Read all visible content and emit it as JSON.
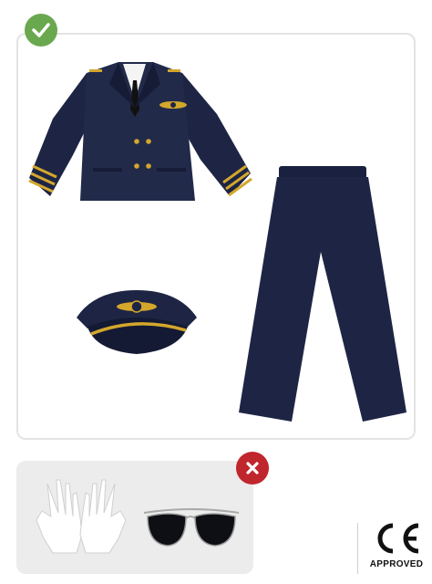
{
  "included": {
    "items": [
      {
        "icon": "pilot-jacket-icon"
      },
      {
        "icon": "pilot-trousers-icon"
      },
      {
        "icon": "pilot-hat-icon"
      }
    ],
    "status_icon": "check-icon",
    "status_color": "#6aa84f"
  },
  "excluded": {
    "items": [
      {
        "icon": "white-gloves-icon"
      },
      {
        "icon": "aviator-sunglasses-icon"
      }
    ],
    "status_icon": "cross-icon",
    "status_color": "#c0262d"
  },
  "certification": {
    "mark": "CE",
    "label": "APPROVED"
  },
  "colors": {
    "uniform": "#1e2544",
    "gold": "#d4a72c",
    "panel_border": "#e3e3e3",
    "excluded_bg": "#ececec"
  }
}
